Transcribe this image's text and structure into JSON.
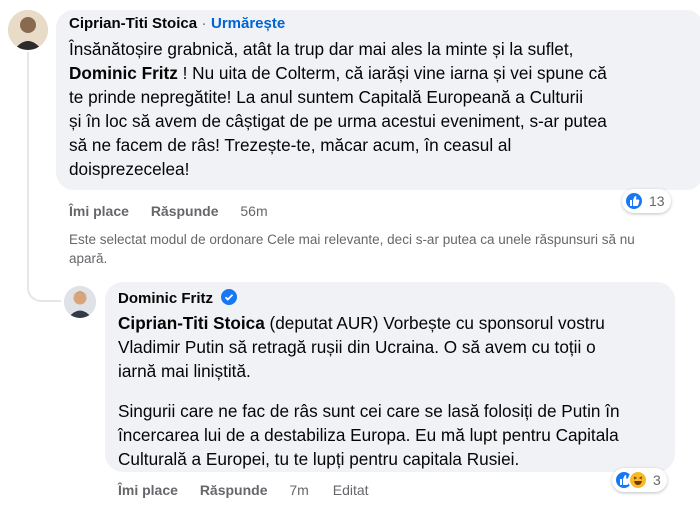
{
  "comment": {
    "author": "Ciprian-Titi Stoica",
    "separator": "·",
    "follow_label": "Urmărește",
    "lines_start": "Însănătoșire grabnică, atât la trup dar mai ales la minte și la suflet,",
    "mention": "Dominic Fritz",
    "lines_after_mention": " ! Nu uita de Colterm, că iarăși vine iarna și vei spune că",
    "line3": "te prinde nepregătite! La anul suntem Capitală Europeană a Culturii",
    "line4": "și în loc să avem de câștigat de pe urma acestui eveniment, s-ar putea",
    "line5": "să ne facem de râs! Trezește-te, măcar acum, în ceasul al",
    "line6": "doisprezecelea!",
    "like_label": "Îmi place",
    "reply_label": "Răspunde",
    "time": "56m",
    "reaction_count": "13"
  },
  "notice": {
    "line1": "Este selectat modul de ordonare Cele mai relevante, deci s-ar putea ca unele răspunsuri să nu",
    "line2": "apară."
  },
  "reply": {
    "author": "Dominic Fritz",
    "mention": "Ciprian-Titi Stoica",
    "p1_after_mention": " (deputat AUR) Vorbește cu sponsorul vostru",
    "p1_line2": "Vladimir Putin să retragă rușii din Ucraina. O să avem cu toții o",
    "p1_line3": "iarnă mai liniștită.",
    "p2_line1": "Singurii care ne fac de râs sunt cei care se lasă folosiți de Putin în",
    "p2_line2": "încercarea lui de a destabiliza Europa. Eu mă lupt pentru Capitala",
    "p2_line3": "Culturală a Europei, tu te lupți pentru capitala Rusiei.",
    "like_label": "Îmi place",
    "reply_label": "Răspunde",
    "time": "7m",
    "edited_label": "Editat",
    "reaction_count": "3"
  },
  "colors": {
    "accent": "#1877f2",
    "bubble": "#f0f2f5",
    "link": "#0064d1",
    "muted": "#65676b"
  },
  "icons": [
    "profile-avatar",
    "verified-badge-icon",
    "like-reaction-icon",
    "haha-reaction-icon"
  ]
}
